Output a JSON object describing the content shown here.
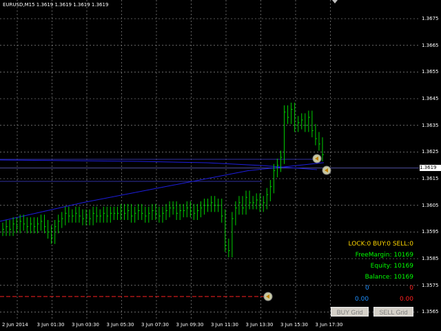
{
  "header": {
    "symbol_text": "EURUSD,M15  1.3619 1.3619 1.3619 1.3619"
  },
  "price_scale": {
    "labels": [
      "1.3675",
      "1.3665",
      "1.3655",
      "1.3645",
      "1.3635",
      "1.3625",
      "1.3615",
      "1.3605",
      "1.3595",
      "1.3585",
      "1.3575",
      "1.3565"
    ],
    "current_price": "1.3619"
  },
  "time_scale": {
    "labels": [
      "2 Jun 2014",
      "3 Jun 01:30",
      "3 Jun 03:30",
      "3 Jun 05:30",
      "3 Jun 07:30",
      "3 Jun 09:30",
      "3 Jun 11:30",
      "3 Jun 13:30",
      "3 Jun 15:30",
      "3 Jun 17:30"
    ]
  },
  "info": {
    "lock_label": "LOCK:0  BUY:0  SELL:0",
    "free_margin": "FreeMargin: 10169",
    "equity": "Equity: 10169",
    "balance": "Balance: 10169",
    "buy_count": "0",
    "sell_count": "0",
    "buy_profit": "0.00",
    "sell_profit": "0.00"
  },
  "buttons": {
    "buy_grid": "BUY Grid",
    "sell_grid": "SELL Grid"
  },
  "colors": {
    "background": "#000000",
    "grid": "#8c8c8c",
    "candle": "#00d000",
    "ma_blue": "#1e1ee0",
    "hline": "#3030a0",
    "red_line": "#ff2020",
    "lock_yellow": "#ffd700",
    "info_green": "#00ff00",
    "buy_blue": "#1e90ff",
    "sell_red": "#ff2020"
  },
  "chart_data": {
    "type": "candlestick",
    "y_range": [
      1.3562,
      1.3682
    ],
    "current_price": 1.3619,
    "close_series": [
      1.3596,
      1.3597,
      1.3596,
      1.3598,
      1.3597,
      1.3599,
      1.3598,
      1.3597,
      1.3598,
      1.3597,
      1.3598,
      1.3599,
      1.3597,
      1.3595,
      1.3593,
      1.3597,
      1.3599,
      1.36,
      1.3602,
      1.3601,
      1.3601,
      1.3602,
      1.3601,
      1.36,
      1.3601,
      1.36,
      1.3602,
      1.3601,
      1.3601,
      1.3602,
      1.3601,
      1.3602,
      1.3602,
      1.3602,
      1.3603,
      1.3602,
      1.3603,
      1.3601,
      1.3602,
      1.3603,
      1.3602,
      1.3601,
      1.3602,
      1.3603,
      1.3602,
      1.3601,
      1.3602,
      1.3603,
      1.3604,
      1.3604,
      1.3602,
      1.3603,
      1.3603,
      1.3604,
      1.3603,
      1.3602,
      1.3603,
      1.3604,
      1.3605,
      1.3605,
      1.3606,
      1.3605,
      1.3605,
      1.3601,
      1.359,
      1.3588,
      1.36,
      1.3604,
      1.3606,
      1.3604,
      1.3608,
      1.3606,
      1.3606,
      1.3607,
      1.3605,
      1.3606,
      1.3609,
      1.3612,
      1.3618,
      1.362,
      1.3623,
      1.364,
      1.3638,
      1.3641,
      1.3635,
      1.3636,
      1.3637,
      1.3635,
      1.3638,
      1.3633,
      1.363,
      1.3628,
      1.3624
    ],
    "series": [
      {
        "name": "",
        "values": [
          1.3599,
          1.3606,
          1.3612,
          1.3618,
          1.3621
        ]
      }
    ]
  }
}
